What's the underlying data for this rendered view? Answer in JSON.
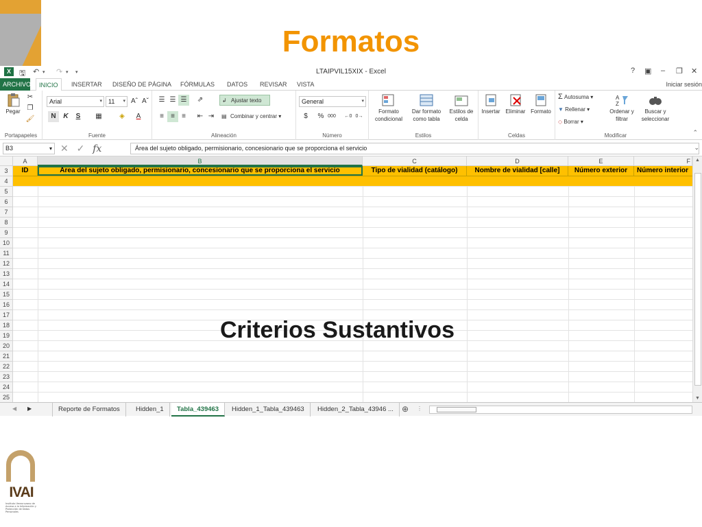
{
  "slide": {
    "title": "Formatos",
    "overlay_text": "Criterios Sustantivos",
    "logo_text": "IVAI",
    "logo_subtitle": "Instituto Veracruzano de Acceso a la Información y Protección de Datos Personales"
  },
  "window": {
    "title": "LTAIPVIL15XIX - Excel",
    "help": "?",
    "signin": "Iniciar sesión"
  },
  "ribbon_tabs": [
    "ARCHIVO",
    "INICIO",
    "INSERTAR",
    "DISEÑO DE PÁGINA",
    "FÓRMULAS",
    "DATOS",
    "REVISAR",
    "VISTA"
  ],
  "active_tab": "INICIO",
  "ribbon": {
    "portapapeles": {
      "paste": "Pegar",
      "label": "Portapapeles"
    },
    "fuente": {
      "font": "Arial",
      "size": "11",
      "bold": "N",
      "italic": "K",
      "underline": "S",
      "label": "Fuente"
    },
    "alineacion": {
      "wrap": "Ajustar texto",
      "merge": "Combinar y centrar",
      "label": "Alineación"
    },
    "numero": {
      "format": "General",
      "currency": "$",
      "percent": "%",
      "comma": "000",
      "label": "Número"
    },
    "estilos": {
      "cond": "Formato condicional",
      "table": "Dar formato como tabla",
      "cell": "Estilos de celda",
      "label": "Estilos"
    },
    "celdas": {
      "insert": "Insertar",
      "delete": "Eliminar",
      "format": "Formato",
      "label": "Celdas"
    },
    "modificar": {
      "autosum": "Autosuma",
      "fill": "Rellenar",
      "clear": "Borrar",
      "sort": "Ordenar y filtrar",
      "find": "Buscar y seleccionar",
      "label": "Modificar"
    }
  },
  "formula_bar": {
    "name_box": "B3",
    "formula": "Área del sujeto obligado, permisionario, concesionario que se proporciona el servicio"
  },
  "columns": [
    "A",
    "B",
    "C",
    "D",
    "E",
    "F"
  ],
  "selected_column": "B",
  "header_row": {
    "row_number": "3",
    "cells": [
      "ID",
      "Área del sujeto obligado, permisionario, concesionario que se proporciona el servicio",
      "Tipo de vialidad (catálogo)",
      "Nombre de vialidad [calle]",
      "Número exterior",
      "Número interior"
    ]
  },
  "row_numbers": [
    "4",
    "5",
    "6",
    "7",
    "8",
    "9",
    "10",
    "11",
    "12",
    "13",
    "14",
    "15",
    "16",
    "17",
    "18",
    "19",
    "20",
    "21",
    "22",
    "23",
    "24",
    "25",
    "26"
  ],
  "sheet_tabs": [
    "Reporte de Formatos",
    "Hidden_1",
    "Tabla_439463",
    "Hidden_1_Tabla_439463",
    "Hidden_2_Tabla_43946 ..."
  ],
  "active_sheet": "Tabla_439463",
  "colors": {
    "excel_green": "#217346",
    "header_fill": "#ffc000",
    "title_orange": "#f29400"
  }
}
